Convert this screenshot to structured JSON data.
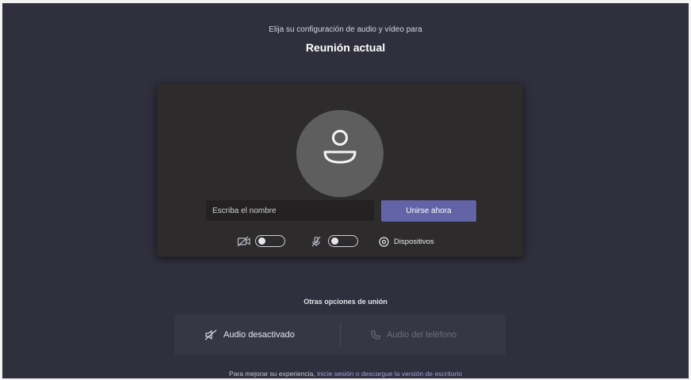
{
  "header": {
    "subtitle": "Elija su configuración de audio y vídeo para",
    "title": "Reunión actual"
  },
  "preview": {
    "avatar_icon": "person-icon",
    "name_placeholder": "Escriba el nombre",
    "name_value": "",
    "join_label": "Unirse ahora",
    "controls": {
      "video_icon": "video-off-icon",
      "video_on": false,
      "mic_icon": "mic-off-icon",
      "mic_on": false,
      "devices_icon": "gear-icon",
      "devices_label": "Dispositivos"
    }
  },
  "other_options": {
    "title": "Otras opciones de unión",
    "audio_off_icon": "speaker-off-icon",
    "audio_off_label": "Audio desactivado",
    "phone_icon": "phone-icon",
    "phone_label": "Audio del teléfono"
  },
  "footer": {
    "prefix": "Para mejorar su experiencia, ",
    "link_text": "inicie sesión o descargue la versión de escritorio"
  },
  "colors": {
    "background": "#2f2f3d",
    "preview_panel": "#2d2b2c",
    "accent": "#6264a7",
    "link": "#9fa1de"
  }
}
